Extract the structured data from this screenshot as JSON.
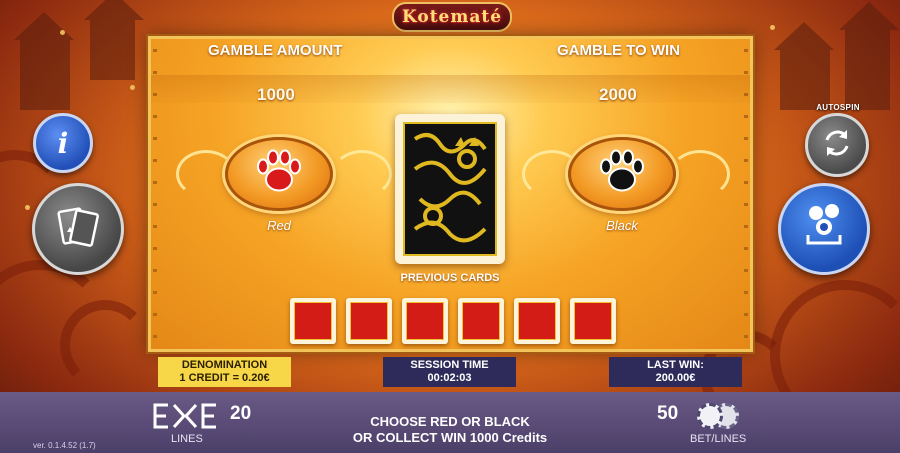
{
  "game": {
    "logo_text": "Kotematé"
  },
  "gamble": {
    "amount_label": "GAMBLE AMOUNT",
    "amount_value": "1000",
    "to_win_label": "GAMBLE TO WIN",
    "to_win_value": "2000",
    "red_label": "Red",
    "black_label": "Black",
    "previous_cards_label": "PREVIOUS CARDS",
    "previous_cards": [
      "red",
      "red",
      "red",
      "red",
      "red",
      "red"
    ]
  },
  "side_buttons": {
    "info": "i",
    "autospin_label": "AUTOSPIN"
  },
  "info_bar": {
    "denomination_title": "DENOMINATION",
    "denomination_value": "1 CREDIT = 0.20€",
    "session_title": "SESSION TIME",
    "session_value": "00:02:03",
    "last_win_title": "LAST WIN:",
    "last_win_value": "200.00€"
  },
  "bottom_bar": {
    "lines_value": "20",
    "lines_label": "LINES",
    "message_line1": "CHOOSE RED OR BLACK",
    "message_line2": "OR COLLECT WIN 1000 Credits",
    "bet_value": "50",
    "bet_label": "BET/LINES",
    "version": "ver. 0.1.4.52 (1.7)"
  },
  "colors": {
    "red_paw": "#d81a1a",
    "black_paw": "#111111",
    "button_blue": "#2250b8",
    "denomination_bg": "#f7d648",
    "bar_bg": "#2e2b5a"
  }
}
